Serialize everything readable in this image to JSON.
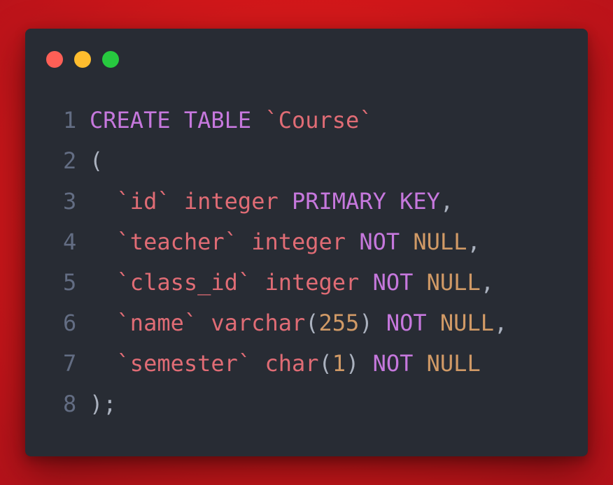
{
  "window": {
    "dots": [
      {
        "name": "close",
        "color": "#ff5f56"
      },
      {
        "name": "minimize",
        "color": "#ffbd2e"
      },
      {
        "name": "maximize",
        "color": "#27c93f"
      }
    ]
  },
  "colors": {
    "keyword": "#c678dd",
    "identifier": "#e06c75",
    "number": "#d19a66",
    "punctuation": "#abb2bf",
    "line_number": "#636d83"
  },
  "code": {
    "lines": [
      {
        "number": "1",
        "tokens": [
          {
            "text": "CREATE TABLE ",
            "type": "keyword"
          },
          {
            "text": "`Course`",
            "type": "identifier"
          }
        ]
      },
      {
        "number": "2",
        "tokens": [
          {
            "text": "(",
            "type": "punctuation"
          }
        ]
      },
      {
        "number": "3",
        "tokens": [
          {
            "text": "  ",
            "type": "punctuation"
          },
          {
            "text": "`id`",
            "type": "identifier"
          },
          {
            "text": " ",
            "type": "punctuation"
          },
          {
            "text": "integer",
            "type": "identifier"
          },
          {
            "text": " ",
            "type": "punctuation"
          },
          {
            "text": "PRIMARY KEY",
            "type": "keyword"
          },
          {
            "text": ",",
            "type": "punctuation"
          }
        ]
      },
      {
        "number": "4",
        "tokens": [
          {
            "text": "  ",
            "type": "punctuation"
          },
          {
            "text": "`teacher`",
            "type": "identifier"
          },
          {
            "text": " ",
            "type": "punctuation"
          },
          {
            "text": "integer",
            "type": "identifier"
          },
          {
            "text": " ",
            "type": "punctuation"
          },
          {
            "text": "NOT",
            "type": "keyword"
          },
          {
            "text": " ",
            "type": "punctuation"
          },
          {
            "text": "NULL",
            "type": "number"
          },
          {
            "text": ",",
            "type": "punctuation"
          }
        ]
      },
      {
        "number": "5",
        "tokens": [
          {
            "text": "  ",
            "type": "punctuation"
          },
          {
            "text": "`class_id`",
            "type": "identifier"
          },
          {
            "text": " ",
            "type": "punctuation"
          },
          {
            "text": "integer",
            "type": "identifier"
          },
          {
            "text": " ",
            "type": "punctuation"
          },
          {
            "text": "NOT",
            "type": "keyword"
          },
          {
            "text": " ",
            "type": "punctuation"
          },
          {
            "text": "NULL",
            "type": "number"
          },
          {
            "text": ",",
            "type": "punctuation"
          }
        ]
      },
      {
        "number": "6",
        "tokens": [
          {
            "text": "  ",
            "type": "punctuation"
          },
          {
            "text": "`name`",
            "type": "identifier"
          },
          {
            "text": " ",
            "type": "punctuation"
          },
          {
            "text": "varchar",
            "type": "identifier"
          },
          {
            "text": "(",
            "type": "punctuation"
          },
          {
            "text": "255",
            "type": "number"
          },
          {
            "text": ") ",
            "type": "punctuation"
          },
          {
            "text": "NOT",
            "type": "keyword"
          },
          {
            "text": " ",
            "type": "punctuation"
          },
          {
            "text": "NULL",
            "type": "number"
          },
          {
            "text": ",",
            "type": "punctuation"
          }
        ]
      },
      {
        "number": "7",
        "tokens": [
          {
            "text": "  ",
            "type": "punctuation"
          },
          {
            "text": "`semester`",
            "type": "identifier"
          },
          {
            "text": " ",
            "type": "punctuation"
          },
          {
            "text": "char",
            "type": "identifier"
          },
          {
            "text": "(",
            "type": "punctuation"
          },
          {
            "text": "1",
            "type": "number"
          },
          {
            "text": ") ",
            "type": "punctuation"
          },
          {
            "text": "NOT",
            "type": "keyword"
          },
          {
            "text": " ",
            "type": "punctuation"
          },
          {
            "text": "NULL",
            "type": "number"
          }
        ]
      },
      {
        "number": "8",
        "tokens": [
          {
            "text": ");",
            "type": "punctuation"
          }
        ]
      }
    ]
  }
}
